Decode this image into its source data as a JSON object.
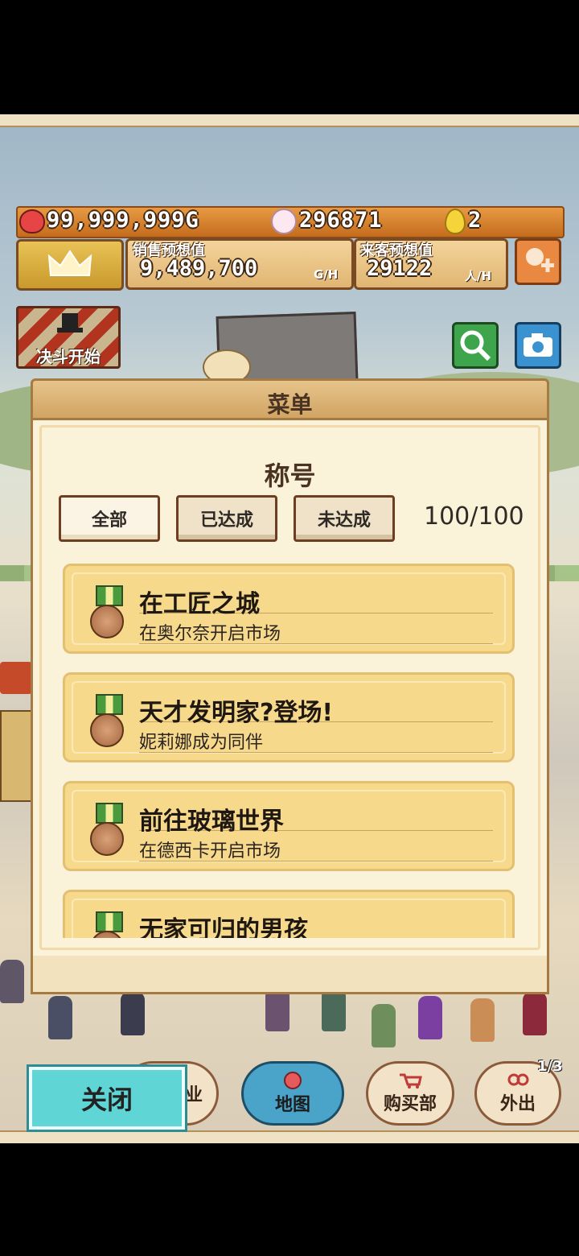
{
  "status": {
    "gold": "99,999,999G",
    "popularity": "296871",
    "eggs": "2"
  },
  "stats": {
    "sales_label": "销售预想值",
    "sales_value": "9,489,700",
    "sales_unit": "G/H",
    "visitors_label": "来客预想值",
    "visitors_value": "29122",
    "visitors_unit": "人/H"
  },
  "duel_button": "决斗开始",
  "modal": {
    "header": "菜单",
    "title": "称号",
    "tabs": [
      "全部",
      "已达成",
      "未达成"
    ],
    "count": "100/100",
    "items": [
      {
        "title": "在工匠之城",
        "desc": "在奥尔奈开启市场"
      },
      {
        "title": "天才发明家?登场!",
        "desc": "妮莉娜成为同伴"
      },
      {
        "title": "前往玻璃世界",
        "desc": "在德西卡开启市场"
      },
      {
        "title": "无家可归的男孩",
        "desc": ""
      }
    ]
  },
  "bottom_nav": {
    "close": "关闭",
    "hidden_label": "业",
    "map": "地图",
    "shop": "购买部",
    "outing": "外出",
    "page_indicator": "1/3"
  },
  "icons": [
    "coin-purse-icon",
    "smiley-face-icon",
    "egg-icon",
    "crown-icon",
    "add-friend-icon",
    "top-hat-icon",
    "magnifier-icon",
    "camera-icon",
    "medal-icon",
    "map-icon",
    "cart-icon",
    "outing-icon"
  ]
}
